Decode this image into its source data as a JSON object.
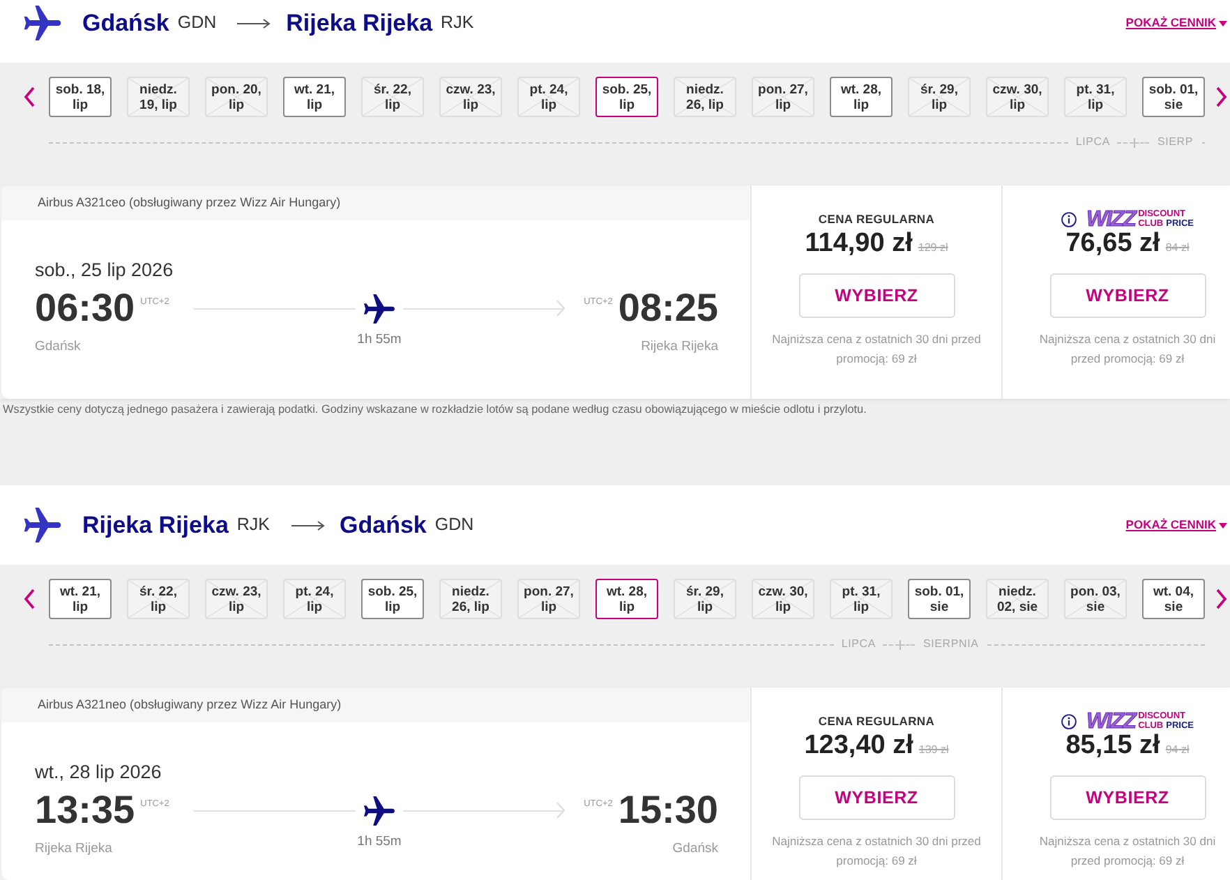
{
  "journeys": [
    {
      "route": {
        "origin": "Gdańsk",
        "origin_code": "GDN",
        "destination": "Rijeka Rijeka",
        "destination_code": "RJK"
      },
      "price_list_link": "POKAŻ CENNIK",
      "months": [
        {
          "label": "LIPCA",
          "days": [
            {
              "lines": [
                "sob. 18,",
                "lip"
              ],
              "disabled": false,
              "selected": false
            },
            {
              "lines": [
                "niedz.",
                "19, lip"
              ],
              "disabled": true,
              "selected": false
            },
            {
              "lines": [
                "pon. 20,",
                "lip"
              ],
              "disabled": true,
              "selected": false
            },
            {
              "lines": [
                "wt. 21,",
                "lip"
              ],
              "disabled": false,
              "selected": false
            },
            {
              "lines": [
                "śr. 22,",
                "lip"
              ],
              "disabled": true,
              "selected": false
            },
            {
              "lines": [
                "czw. 23,",
                "lip"
              ],
              "disabled": true,
              "selected": false
            },
            {
              "lines": [
                "pt. 24,",
                "lip"
              ],
              "disabled": true,
              "selected": false
            },
            {
              "lines": [
                "sob. 25,",
                "lip"
              ],
              "disabled": false,
              "selected": true
            },
            {
              "lines": [
                "niedz.",
                "26, lip"
              ],
              "disabled": true,
              "selected": false
            },
            {
              "lines": [
                "pon. 27,",
                "lip"
              ],
              "disabled": true,
              "selected": false
            },
            {
              "lines": [
                "wt. 28,",
                "lip"
              ],
              "disabled": false,
              "selected": false
            },
            {
              "lines": [
                "śr. 29,",
                "lip"
              ],
              "disabled": true,
              "selected": false
            },
            {
              "lines": [
                "czw. 30,",
                "lip"
              ],
              "disabled": true,
              "selected": false
            },
            {
              "lines": [
                "pt. 31,",
                "lip"
              ],
              "disabled": true,
              "selected": false
            }
          ]
        },
        {
          "label": "SIERP",
          "days": [
            {
              "lines": [
                "sob. 01,",
                "sie"
              ],
              "disabled": false,
              "selected": false
            }
          ]
        }
      ],
      "flight": {
        "aircraft": "Airbus A321ceo (obsługiwany przez Wizz Air Hungary)",
        "date": "sob., 25 lip 2026",
        "departure": {
          "time": "06:30",
          "timezone": "UTC+2",
          "city": "Gdańsk"
        },
        "duration": "1h 55m",
        "arrival": {
          "time": "08:25",
          "timezone": "UTC+2",
          "city": "Rijeka Rijeka"
        }
      },
      "fares": [
        {
          "kind": "regular",
          "title": "CENA REGULARNA",
          "price": "114,90 zł",
          "old_price": "129 zł",
          "button": "WYBIERZ",
          "note": "Najniższa cena z ostatnich 30 dni przed promocją: 69 zł"
        },
        {
          "kind": "club",
          "logo": {
            "wordmark": "WIZZ",
            "words": [
              "DISCOUNT",
              "CLUB",
              "PRICE"
            ]
          },
          "price": "76,65 zł",
          "old_price": "84 zł",
          "button": "WYBIERZ",
          "note": "Najniższa cena z ostatnich 30 dni przed promocją: 69 zł"
        }
      ],
      "disclaimer": "Wszystkie ceny dotyczą jednego pasażera i zawierają podatki. Godziny wskazane w rozkładzie lotów są podane według czasu obowiązującego w mieście odlotu i przylotu."
    },
    {
      "route": {
        "origin": "Rijeka Rijeka",
        "origin_code": "RJK",
        "destination": "Gdańsk",
        "destination_code": "GDN"
      },
      "price_list_link": "POKAŻ CENNIK",
      "months": [
        {
          "label": "LIPCA",
          "days": [
            {
              "lines": [
                "wt. 21,",
                "lip"
              ],
              "disabled": false,
              "selected": false
            },
            {
              "lines": [
                "śr. 22,",
                "lip"
              ],
              "disabled": true,
              "selected": false
            },
            {
              "lines": [
                "czw. 23,",
                "lip"
              ],
              "disabled": true,
              "selected": false
            },
            {
              "lines": [
                "pt. 24,",
                "lip"
              ],
              "disabled": true,
              "selected": false
            },
            {
              "lines": [
                "sob. 25,",
                "lip"
              ],
              "disabled": false,
              "selected": false
            },
            {
              "lines": [
                "niedz.",
                "26, lip"
              ],
              "disabled": true,
              "selected": false
            },
            {
              "lines": [
                "pon. 27,",
                "lip"
              ],
              "disabled": true,
              "selected": false
            },
            {
              "lines": [
                "wt. 28,",
                "lip"
              ],
              "disabled": false,
              "selected": true
            },
            {
              "lines": [
                "śr. 29,",
                "lip"
              ],
              "disabled": true,
              "selected": false
            },
            {
              "lines": [
                "czw. 30,",
                "lip"
              ],
              "disabled": true,
              "selected": false
            },
            {
              "lines": [
                "pt. 31,",
                "lip"
              ],
              "disabled": true,
              "selected": false
            }
          ]
        },
        {
          "label": "SIERPNIA",
          "days": [
            {
              "lines": [
                "sob. 01,",
                "sie"
              ],
              "disabled": false,
              "selected": false
            },
            {
              "lines": [
                "niedz.",
                "02, sie"
              ],
              "disabled": true,
              "selected": false
            },
            {
              "lines": [
                "pon. 03,",
                "sie"
              ],
              "disabled": true,
              "selected": false
            },
            {
              "lines": [
                "wt. 04,",
                "sie"
              ],
              "disabled": false,
              "selected": false
            }
          ]
        }
      ],
      "flight": {
        "aircraft": "Airbus A321neo (obsługiwany przez Wizz Air Hungary)",
        "date": "wt., 28 lip 2026",
        "departure": {
          "time": "13:35",
          "timezone": "UTC+2",
          "city": "Rijeka Rijeka"
        },
        "duration": "1h 55m",
        "arrival": {
          "time": "15:30",
          "timezone": "UTC+2",
          "city": "Gdańsk"
        }
      },
      "fares": [
        {
          "kind": "regular",
          "title": "CENA REGULARNA",
          "price": "123,40 zł",
          "old_price": "139 zł",
          "button": "WYBIERZ",
          "note": "Najniższa cena z ostatnich 30 dni przed promocją: 69 zł"
        },
        {
          "kind": "club",
          "logo": {
            "wordmark": "WIZZ",
            "words": [
              "DISCOUNT",
              "CLUB",
              "PRICE"
            ]
          },
          "price": "85,15 zł",
          "old_price": "94 zł",
          "button": "WYBIERZ",
          "note": "Najniższa cena z ostatnich 30 dni przed promocją: 69 zł"
        }
      ]
    }
  ]
}
